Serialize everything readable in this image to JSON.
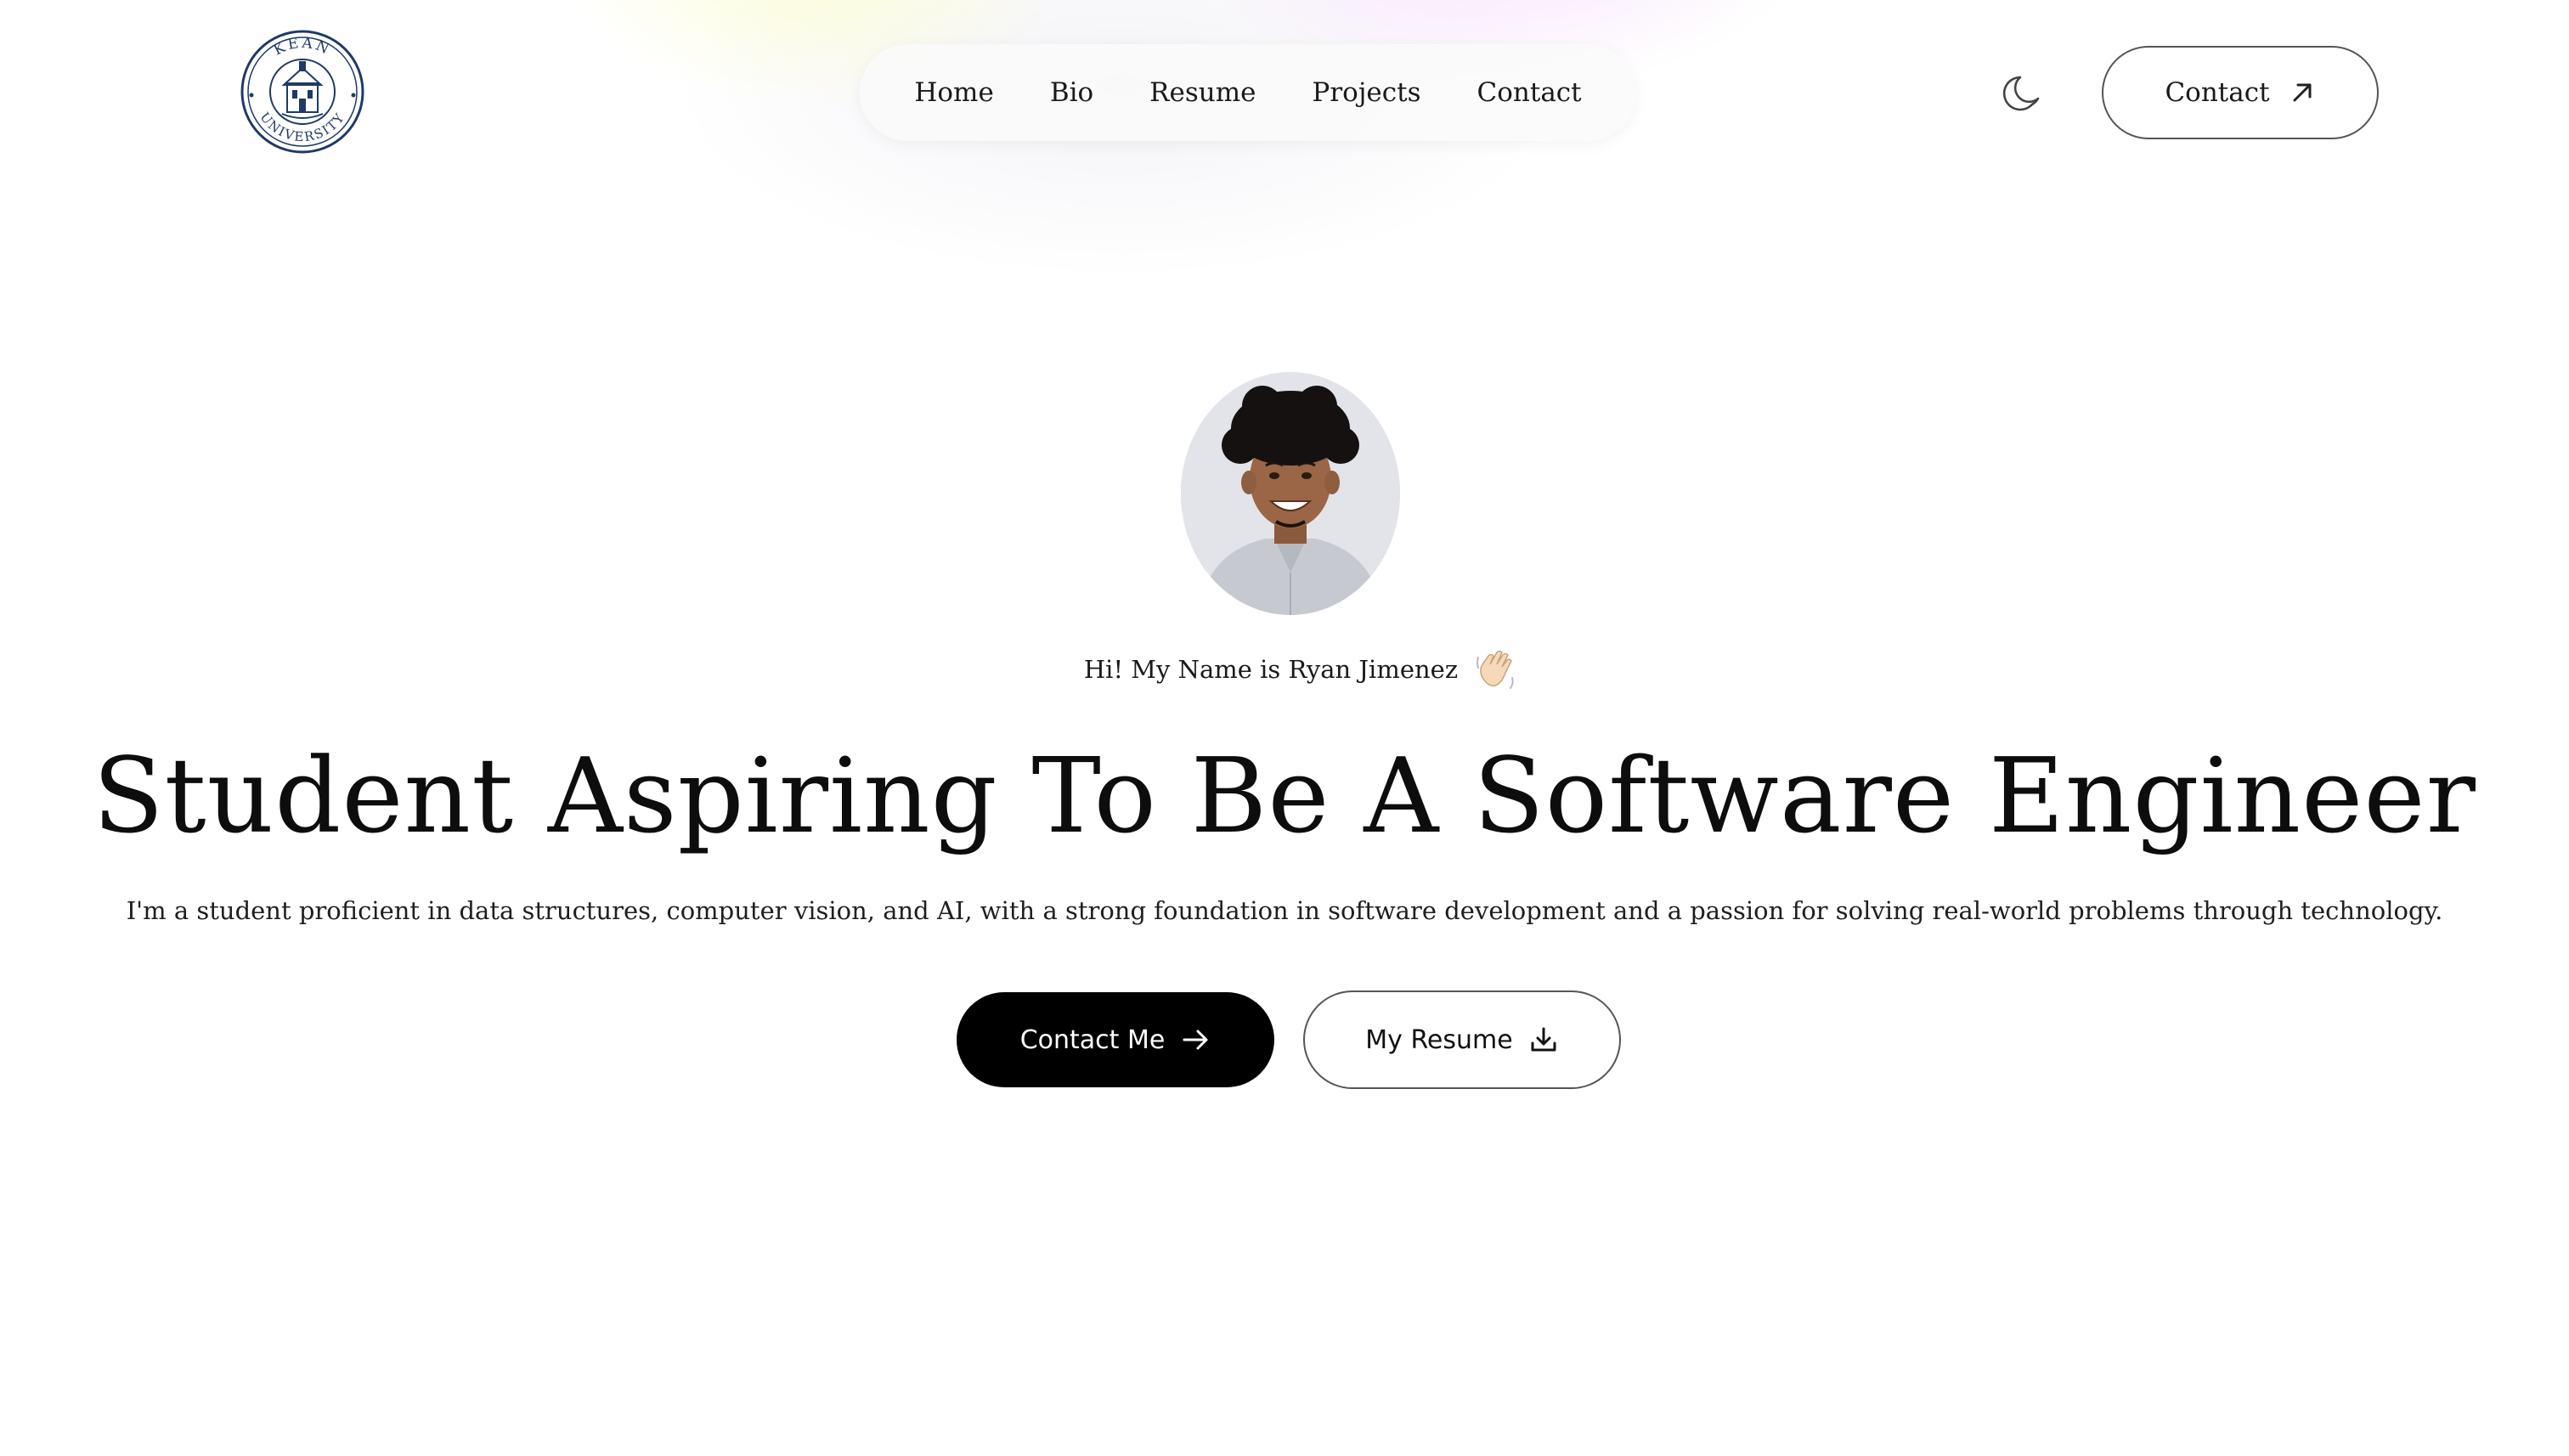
{
  "header": {
    "logo": {
      "icon": "kean-university-seal-icon",
      "text": "KEAN UNIVERSITY",
      "color": "#1f3a66"
    },
    "nav": [
      {
        "label": "Home"
      },
      {
        "label": "Bio"
      },
      {
        "label": "Resume"
      },
      {
        "label": "Projects"
      },
      {
        "label": "Contact"
      }
    ],
    "theme_toggle_icon": "moon-icon",
    "contact_button": {
      "label": "Contact",
      "icon": "arrow-up-right-icon"
    }
  },
  "hero": {
    "avatar_icon": "profile-photo",
    "greeting": "Hi! My Name is Ryan Jimenez",
    "greeting_icon": "waving-hand-icon",
    "headline": "Student Aspiring To Be A Software Engineer",
    "subtitle": "I'm a student proficient in data structures, computer vision, and AI, with a strong foundation in software development and a passion for solving real-world problems through technology.",
    "primary_button": {
      "label": "Contact Me",
      "icon": "arrow-right-icon"
    },
    "secondary_button": {
      "label": "My Resume",
      "icon": "download-icon"
    }
  },
  "colors": {
    "background": "#ffffff",
    "primary_button_bg": "#000000",
    "primary_button_text": "#ffffff",
    "logo_navy": "#1f3a66"
  }
}
